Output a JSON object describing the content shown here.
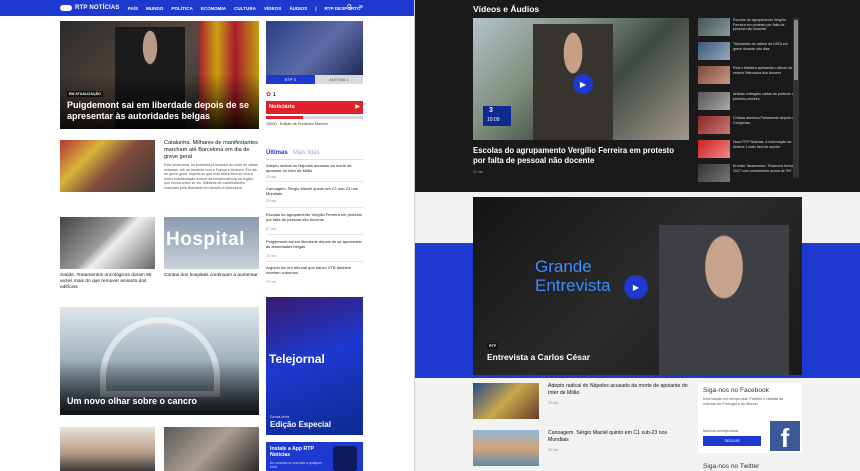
{
  "header": {
    "logo_text": "RTP NOTÍCIAS",
    "nav": [
      "PAÍS",
      "MUNDO",
      "POLÍTICA",
      "ECONOMIA",
      "CULTURA",
      "VÍDEOS",
      "ÁUDIOS",
      "|",
      "RTP DESPORTO"
    ]
  },
  "hero": {
    "tag": "EM ATUALIZAÇÃO",
    "title": "Puigdemont sai em liberdade depois de se apresentar às autoridades belgas"
  },
  "live": {
    "btn1": "RTP 3",
    "btn2": "ANTENA 1"
  },
  "radio": {
    "count": "1",
    "title": "Noticiário",
    "subtitle": "10h00 - Edição de Frederico Moreno"
  },
  "catalunha": {
    "title": "Catalunha. Milhares de manifestantes marcham até Barcelona em dia de greve geral",
    "body": "Este sexta-feira, os protestos já levaram ao corte de várias estradas, até na fronteira com a França e Andorra. Em dia de greve geral, espera-se que esta sexta-feira se viva a maior manifestação a favor da independência na região, que nunca antes se viu. Milhares de manifestantes marcham pela liberdade em direção a Barcelona."
  },
  "tabs": {
    "active": "Últimas",
    "inactive": "Mais lidas"
  },
  "latest": [
    {
      "text": "Adepto radical do Nápoles acusado da morte de apoiante do Inter de Milão",
      "time": "25 min."
    },
    {
      "text": "Canoagem. Sérgio Maciel quinto em C1 sub-23 nos Mundiais",
      "time": "25 min."
    },
    {
      "text": "Escolas do agrupamento Vergílio Ferreira em protesto por falta de pessoal não docente",
      "time": "27 min."
    },
    {
      "text": "Puigdemont sai em liberdade depois de se apresentar às autoridades belgas",
      "time": "28 min."
    },
    {
      "text": "Arguido diz em tribunal que banco VTB também recebeu subornos",
      "time": "29 min."
    }
  ],
  "cards": {
    "saude": "Saúde. Tratamentos oncológicos duram 50 vezes mais do que remover amianto dos edifícios",
    "hospital_img": "Hospital",
    "hospital": "Contas dos hospitais continuam a aumentar",
    "cancro": "Um novo olhar sobre o cancro",
    "telejornal_logo": "Telejornal",
    "telejornal_day": "Sexta-feira",
    "telejornal_title": "Edição Especial",
    "app_title": "Instale a App RTP Notícias",
    "app_sub": "As notícias na sua mão a qualquer hora"
  },
  "videos": {
    "section": "Vídeos e Áudios",
    "main_title": "Escolas do agrupamento Vergílio Ferreira em protesto por falta de pessoal não docente",
    "main_time": "22 min.",
    "overlay_clock": "10:09",
    "overlay_channel": "3",
    "list": [
      "Escolas do agrupamento Vergílio Ferreira em protesto por falta de pessoal não docente",
      "Tripulantes de cabine da SATA em greve durante oito dias",
      "Pedro Madeira apresenta o álbum de estreia 'Mercados dos Amores'",
      "Artistas entregam cartas de protesto ao primeiro-ministro",
      "Críticas abertura Parlamento depois de Congresso",
      "Novo RTP Notícias. A Informação da Antena 1 mais fácil de aceder",
      "Ernesto Tarasmeriro: 'Podemos fechar 2017 com crescimento acima de 3%'"
    ]
  },
  "entrevista": {
    "logo_line1": "Grande",
    "logo_line2": "Entrevista",
    "tag": "RTP",
    "title": "Entrevista a Carlos César"
  },
  "bottom": [
    {
      "text": "Adepto radical do Nápoles acusado da morte de apoiante do Inter de Milão",
      "time": "25 min."
    },
    {
      "text": "Canoagem. Sérgio Maciel quinto em C1 sub-23 nos Mundiais",
      "time": "25 min."
    }
  ],
  "facebook": {
    "title": "Siga-nos no Facebook",
    "body": "Informação em tempo real. Partilhe e debata as notícias de Portugal e do Mundo.",
    "url": "facebook.com/rtpnoticias",
    "button": "SEGUIR"
  },
  "twitter": {
    "title": "Siga-nos no Twitter"
  },
  "colors": {
    "brand": "#1d39d0",
    "dark": "#1a1a1a",
    "accent_red": "#e0202a"
  }
}
